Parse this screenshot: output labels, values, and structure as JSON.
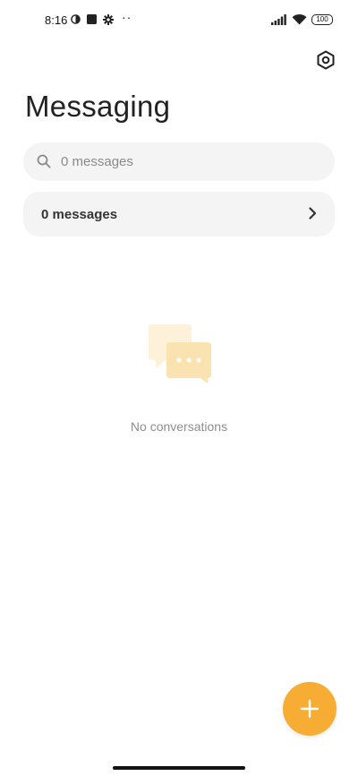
{
  "status_bar": {
    "time": "8:16",
    "battery_text": "100",
    "more_indicator": "··",
    "icons": [
      "data-saver-icon",
      "square-notification-icon",
      "gear-notification-icon",
      "signal-icon",
      "wifi-icon",
      "battery-icon"
    ]
  },
  "header": {
    "title": "Messaging",
    "settings_icon": "settings-hexagon-icon"
  },
  "search": {
    "placeholder": "0 messages",
    "icon": "search-icon"
  },
  "messages_row": {
    "label": "0 messages",
    "icon": "chevron-right-icon"
  },
  "empty_state": {
    "text": "No conversations",
    "icon": "chat-bubbles-icon"
  },
  "fab": {
    "icon": "plus-icon"
  },
  "colors": {
    "accent": "#f7ad34",
    "surface": "#f4f4f4",
    "illustration_light": "#fdf1d9",
    "illustration_mid": "#fbe3b1"
  }
}
